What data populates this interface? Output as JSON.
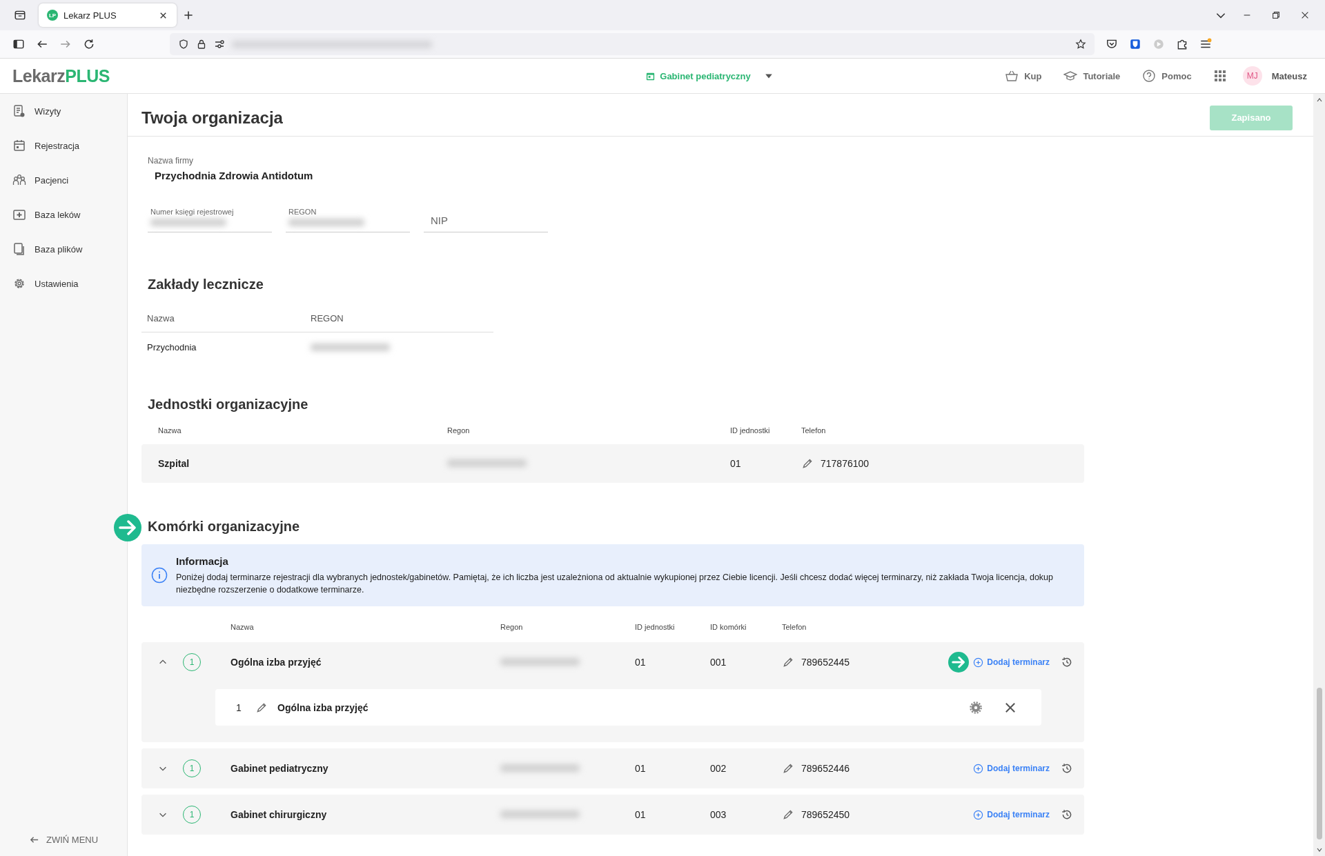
{
  "browser": {
    "tab": {
      "favicon_text": "LP",
      "title": "Lekarz PLUS",
      "selected": true
    },
    "address": {
      "value_hidden": true
    }
  },
  "app_header": {
    "logo": {
      "part_1": "Lekarz",
      "part_2": "PLUS"
    },
    "context": "Gabinet pediatryczny",
    "nav": [
      "Kup",
      "Tutoriale",
      "Pomoc"
    ],
    "user": {
      "initials": "MJ",
      "name": "Mateusz"
    }
  },
  "sidebar": {
    "items": [
      {
        "label": "Wizyty",
        "selected": false
      },
      {
        "label": "Rejestracja",
        "selected": false
      },
      {
        "label": "Pacjenci",
        "selected": false
      },
      {
        "label": "Baza leków",
        "selected": false
      },
      {
        "label": "Baza plików",
        "selected": false
      },
      {
        "label": "Ustawienia",
        "selected": false
      }
    ],
    "collapse": "ZWIŃ MENU"
  },
  "page": {
    "title": "Twoja organizacja",
    "save_button": {
      "label": "Zapisano",
      "disabled": true
    }
  },
  "company": {
    "label": "Nazwa firmy",
    "value": "Przychodnia Zdrowia Antidotum",
    "fields": [
      {
        "label": "Numer księgi rejestrowej",
        "value_hidden": true
      },
      {
        "label": "REGON",
        "value_hidden": true
      },
      {
        "placeholder": "NIP",
        "value_hidden": false
      }
    ]
  },
  "facilities": {
    "title": "Zakłady lecznicze",
    "columns": [
      "Nazwa",
      "REGON"
    ],
    "rows": [
      {
        "name": "Przychodnia",
        "regon_hidden": true
      }
    ]
  },
  "units": {
    "title": "Jednostki organizacyjne",
    "columns": [
      "Nazwa",
      "Regon",
      "ID jednostki",
      "Telefon"
    ],
    "rows": [
      {
        "name": "Szpital",
        "regon_hidden": true,
        "id": "01",
        "phone": "717876100"
      }
    ]
  },
  "cells": {
    "title": "Komórki organizacyjne",
    "pointer": true,
    "info": {
      "title": "Informacja",
      "text": "Poniżej dodaj terminarze rejestracji dla wybranych jednostek/gabinetów. Pamiętaj, że ich liczba jest uzależniona od aktualnie wykupionej przez Ciebie licencji. Jeśli chcesz dodać więcej terminarzy, niż zakłada Twoja licencja, dokup niezbędne rozszerzenie o dodatkowe terminarze."
    },
    "columns": [
      "Nazwa",
      "Regon",
      "ID jednostki",
      "ID komórki",
      "Telefon"
    ],
    "rows": [
      {
        "expanded": true,
        "count": "1",
        "name": "Ogólna izba przyjęć",
        "regon_hidden": true,
        "unit_id": "01",
        "cell_id": "001",
        "phone": "789652445",
        "action": "Dodaj terminarz",
        "pointer": true,
        "calendars": [
          {
            "number": "1",
            "name": "Ogólna izba przyjęć"
          }
        ]
      },
      {
        "expanded": false,
        "count": "1",
        "name": "Gabinet pediatryczny",
        "regon_hidden": true,
        "unit_id": "01",
        "cell_id": "002",
        "phone": "789652446",
        "action": "Dodaj terminarz",
        "pointer": false
      },
      {
        "expanded": false,
        "count": "1",
        "name": "Gabinet chirurgiczny",
        "regon_hidden": true,
        "unit_id": "01",
        "cell_id": "003",
        "phone": "789652450",
        "action": "Dodaj terminarz",
        "pointer": false
      }
    ]
  }
}
